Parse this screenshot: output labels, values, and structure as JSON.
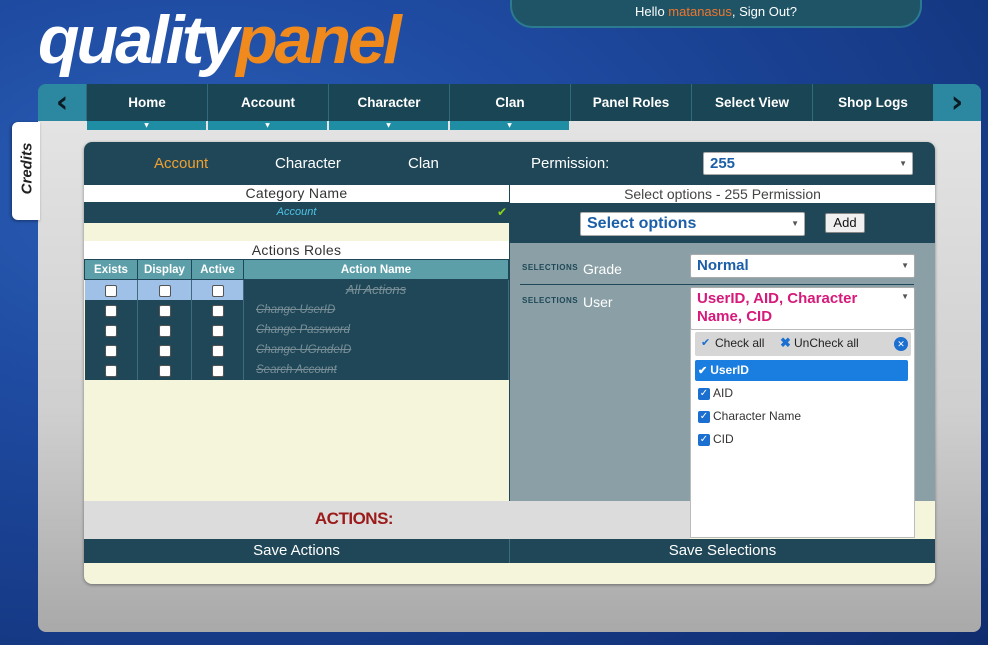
{
  "logo": {
    "part1": "quality",
    "part2": "panel"
  },
  "greeting": {
    "hello": "Hello ",
    "user": "matanasus",
    "signout": ", Sign Out?"
  },
  "nav": {
    "prev_icon": "chevron-left-icon",
    "next_icon": "chevron-right-icon",
    "items": [
      {
        "label": "Home",
        "dropdown": true
      },
      {
        "label": "Account",
        "dropdown": true
      },
      {
        "label": "Character",
        "dropdown": true
      },
      {
        "label": "Clan",
        "dropdown": true
      },
      {
        "label": "Panel Roles",
        "dropdown": false
      },
      {
        "label": "Select View",
        "dropdown": false
      },
      {
        "label": "Shop Logs",
        "dropdown": false
      }
    ]
  },
  "credits": "Credits",
  "category_tabs": [
    "Account",
    "Character",
    "Clan"
  ],
  "active_category_tab": "Account",
  "permission": {
    "label": "Permission:",
    "value": "255"
  },
  "category": {
    "header": "Category Name",
    "row": "Account"
  },
  "actions_roles": {
    "header": "Actions Roles",
    "columns": [
      "Exists",
      "Display",
      "Active",
      "Action Name"
    ],
    "rows": [
      "All Actions",
      "Change UserID",
      "Change Password",
      "Change UGradeID",
      "Search Account"
    ]
  },
  "options": {
    "header": "Select options - 255 Permission",
    "select_placeholder": "Select options",
    "add_label": "Add"
  },
  "selections": {
    "tag": "SELECTIONS",
    "grade": {
      "label": "Grade",
      "value": "Normal"
    },
    "user": {
      "label": "User",
      "value": "UserID, AID, Character Name, CID"
    }
  },
  "multiselect": {
    "check_all": "Check all",
    "uncheck_all": "UnCheck all",
    "items": [
      "UserID",
      "AID",
      "Character Name",
      "CID"
    ]
  },
  "actions_label": "ACTIONS:",
  "save_actions": "Save Actions",
  "save_selections": "Save Selections",
  "colors": {
    "accent_orange": "#f08a1d",
    "teal_dark": "#1f4757",
    "link_blue": "#1b5fa8",
    "user_magenta": "#d6197a",
    "actions_red": "#9b1a1a"
  }
}
